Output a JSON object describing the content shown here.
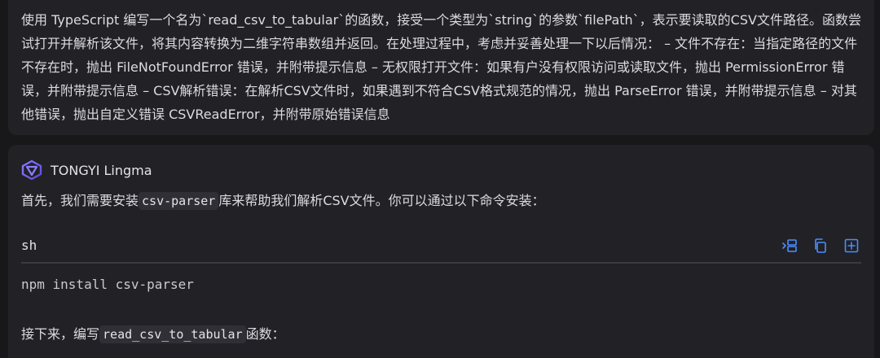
{
  "user_message": {
    "text": "使用 TypeScript 编写一个名为`read_csv_to_tabular`的函数，接受一个类型为`string`的参数`filePath`，表示要读取的CSV文件路径。函数尝试打开并解析该文件，将其内容转换为二维字符串数组并返回。在处理过程中，考虑并妥善处理一下以后情况： – 文件不存在：当指定路径的文件不存在时，抛出 FileNotFoundError 错误，并附带提示信息 – 无权限打开文件：如果有户没有权限访问或读取文件，抛出 PermissionError 错误，并附带提示信息 – CSV解析错误：在解析CSV文件时，如果遇到不符合CSV格式规范的情况，抛出 ParseError 错误，并附带提示信息 – 对其他错误，抛出自定义错误 CSVReadError，并附带原始错误信息"
  },
  "assistant": {
    "name": "TONGYI Lingma",
    "logo_icon": "tongyi-logo-icon",
    "intro_before": "首先，我们需要安装",
    "intro_code": "csv-parser",
    "intro_after": "库来帮助我们解析CSV文件。你可以通过以下命令安装：",
    "code_block": {
      "language": "sh",
      "code": "npm install csv-parser",
      "tools": [
        "insert-icon",
        "copy-icon",
        "new-file-icon"
      ]
    },
    "next_before": "接下来，编写",
    "next_code": "read_csv_to_tabular",
    "next_after": "函数："
  },
  "colors": {
    "background": "#18181b",
    "card": "#212126",
    "accent_icon": "#4c8dff"
  }
}
